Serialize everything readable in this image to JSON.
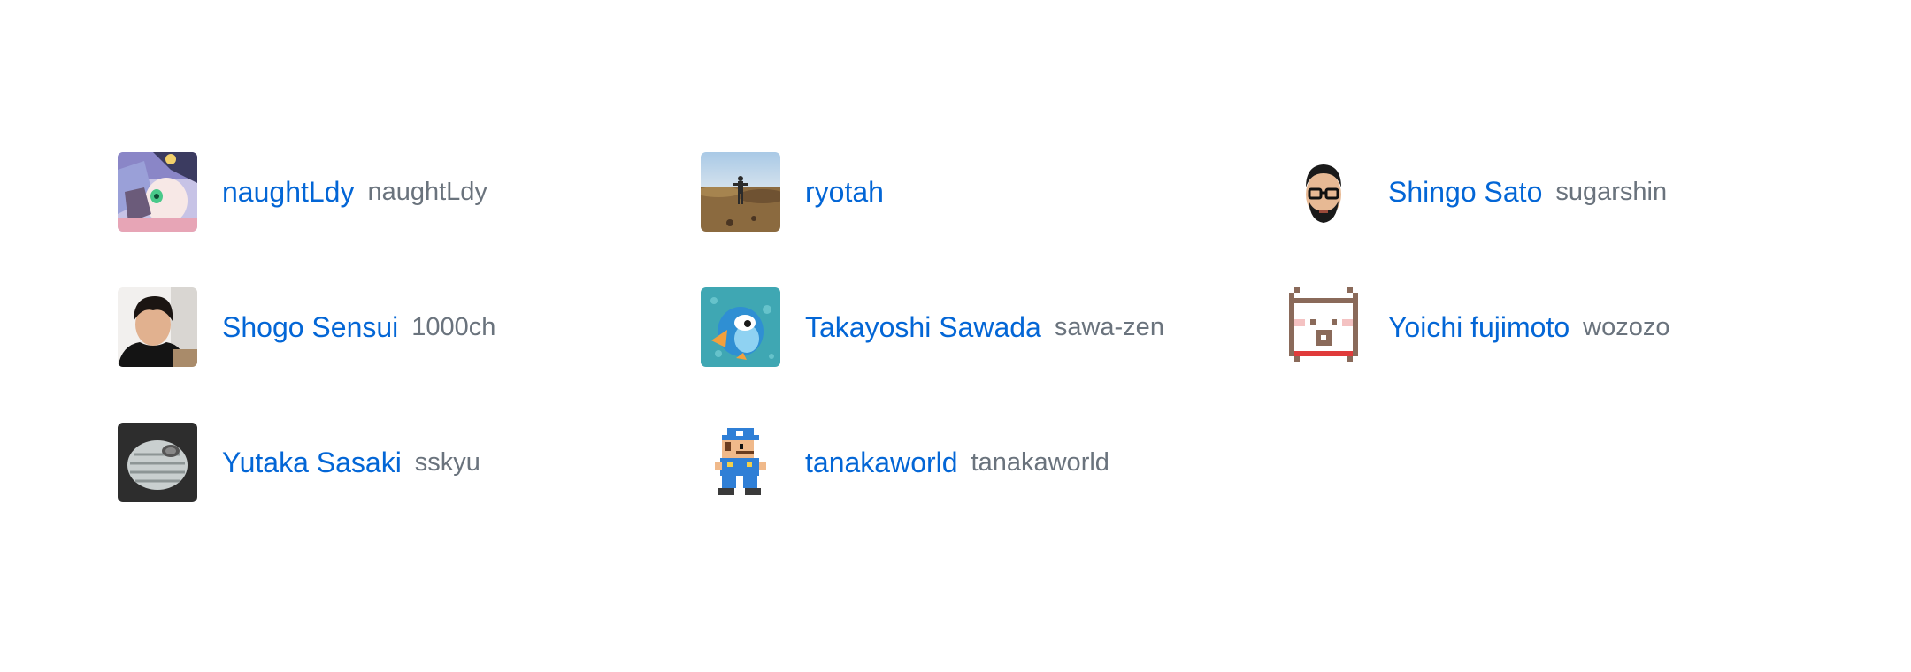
{
  "members": [
    {
      "name": "naughtLdy",
      "login": "naughtLdy",
      "avatar": "anime-avatar-icon"
    },
    {
      "name": "ryotah",
      "login": "",
      "avatar": "beach-photo-avatar"
    },
    {
      "name": "Shingo Sato",
      "login": "sugarshin",
      "avatar": "glasses-man-avatar"
    },
    {
      "name": "Shogo Sensui",
      "login": "1000ch",
      "avatar": "portrait-photo-avatar"
    },
    {
      "name": "Takayoshi Sawada",
      "login": "sawa-zen",
      "avatar": "blue-bird-avatar"
    },
    {
      "name": "Yoichi fujimoto",
      "login": "wozozo",
      "avatar": "pixel-pig-avatar"
    },
    {
      "name": "Yutaka Sasaki",
      "login": "sskyu",
      "avatar": "hot-water-bottle-avatar"
    },
    {
      "name": "tanakaworld",
      "login": "tanakaworld",
      "avatar": "pixel-plumber-avatar"
    }
  ]
}
